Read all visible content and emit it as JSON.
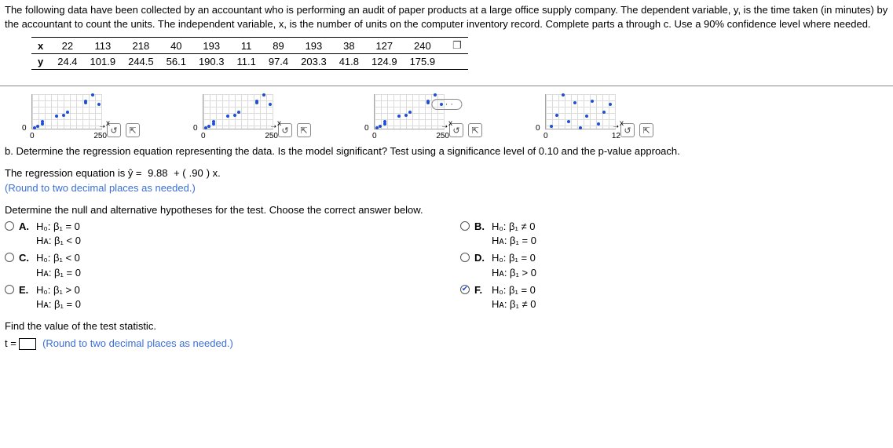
{
  "intro": "The following data have been collected by an accountant who is performing an audit of paper products at a large office supply company. The dependent variable, y, is the time taken (in minutes) by the accountant to count the units. The independent variable, x, is the number of units on the computer inventory record. Complete parts a through c. Use a 90% confidence level where needed.",
  "table": {
    "rowlabels": {
      "x": "x",
      "y": "y"
    },
    "x": [
      "22",
      "113",
      "218",
      "40",
      "193",
      "11",
      "89",
      "193",
      "38",
      "127",
      "240"
    ],
    "y": [
      "24.4",
      "101.9",
      "244.5",
      "56.1",
      "190.3",
      "11.1",
      "97.4",
      "203.3",
      "41.8",
      "124.9",
      "175.9"
    ]
  },
  "dots": "· · ·",
  "charts": {
    "axis0": "0",
    "xmaxA": "250",
    "xmaxB": "12",
    "xvar": "x",
    "ylab": "0"
  },
  "partB": {
    "prompt": "b. Determine the regression equation representing the data. Is the model significant? Test using a significance level of 0.10 and the p-value approach.",
    "eq_prefix": "The regression equation is ŷ = ",
    "b0": "9.88",
    "plus": " + ",
    "b1": ".90",
    "eq_suffix": " x.",
    "round_hint": "(Round to two decimal places as needed.)",
    "hyp_prompt": "Determine the null and alternative hypotheses for the test. Choose the correct answer below."
  },
  "options": {
    "A": {
      "letter": "A.",
      "h0": "H₀: β₁ = 0",
      "ha": "Hᴀ: β₁ < 0"
    },
    "B": {
      "letter": "B.",
      "h0": "H₀: β₁ ≠ 0",
      "ha": "Hᴀ: β₁ = 0"
    },
    "C": {
      "letter": "C.",
      "h0": "H₀: β₁ < 0",
      "ha": "Hᴀ: β₁ = 0"
    },
    "D": {
      "letter": "D.",
      "h0": "H₀: β₁ = 0",
      "ha": "Hᴀ: β₁ > 0"
    },
    "E": {
      "letter": "E.",
      "h0": "H₀: β₁ > 0",
      "ha": "Hᴀ: β₁ = 0"
    },
    "F": {
      "letter": "F.",
      "h0": "H₀: β₁ = 0",
      "ha": "Hᴀ: β₁ ≠ 0"
    }
  },
  "teststat": {
    "prompt": "Find the value of the test statistic.",
    "prefix": "t = ",
    "hint": "(Round to two decimal places as needed.)"
  },
  "chart_data": [
    {
      "type": "scatter",
      "x": [
        22,
        113,
        218,
        40,
        193,
        11,
        89,
        193,
        38,
        127,
        240
      ],
      "y": [
        24.4,
        101.9,
        244.5,
        56.1,
        190.3,
        11.1,
        97.4,
        203.3,
        41.8,
        124.9,
        175.9
      ],
      "xlim": [
        0,
        250
      ],
      "ylim": [
        0,
        250
      ],
      "xlabel": "x",
      "ylabel": ""
    },
    {
      "type": "scatter",
      "x": [
        22,
        113,
        218,
        40,
        193,
        11,
        89,
        193,
        38,
        127,
        240
      ],
      "y": [
        24.4,
        101.9,
        244.5,
        56.1,
        190.3,
        11.1,
        97.4,
        203.3,
        41.8,
        124.9,
        175.9
      ],
      "xlim": [
        0,
        250
      ],
      "ylim": [
        0,
        250
      ],
      "xlabel": "x",
      "ylabel": ""
    },
    {
      "type": "scatter",
      "x": [
        22,
        113,
        218,
        40,
        193,
        11,
        89,
        193,
        38,
        127,
        240
      ],
      "y": [
        24.4,
        101.9,
        244.5,
        56.1,
        190.3,
        11.1,
        97.4,
        203.3,
        41.8,
        124.9,
        175.9
      ],
      "xlim": [
        0,
        250
      ],
      "ylim": [
        0,
        250
      ],
      "xlabel": "x",
      "ylabel": ""
    },
    {
      "type": "scatter",
      "x": [
        1,
        2,
        3,
        4,
        5,
        6,
        7,
        8,
        9,
        10,
        11
      ],
      "y": [
        24.4,
        101.9,
        244.5,
        56.1,
        190.3,
        11.1,
        97.4,
        203.3,
        41.8,
        124.9,
        175.9
      ],
      "xlim": [
        0,
        12
      ],
      "ylim": [
        0,
        250
      ],
      "xlabel": "x",
      "ylabel": ""
    }
  ]
}
